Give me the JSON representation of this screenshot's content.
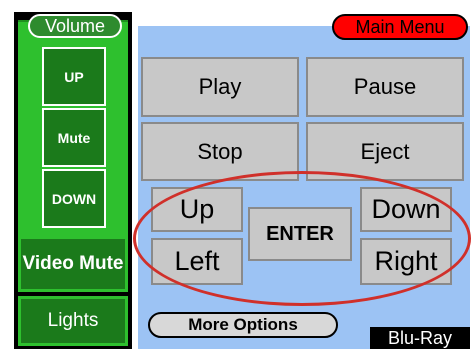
{
  "volume": {
    "title": "Volume",
    "up_label": "UP",
    "mute_label": "Mute",
    "down_label": "DOWN"
  },
  "sidebar": {
    "video_mute_label": "Video Mute",
    "lights_label": "Lights"
  },
  "main": {
    "menu_label": "Main Menu",
    "play_label": "Play",
    "pause_label": "Pause",
    "stop_label": "Stop",
    "eject_label": "Eject",
    "up_label": "Up",
    "down_label": "Down",
    "enter_label": "ENTER",
    "left_label": "Left",
    "right_label": "Right",
    "more_options_label": "More Options",
    "source_label": "Blu-Ray"
  },
  "colors": {
    "panel_green": "#2ec02e",
    "button_green": "#1b7a1b",
    "panel_blue": "#9cc3f4",
    "menu_red": "#ff0000",
    "button_gray": "#c8c8c8",
    "highlight_ring": "#d0302a"
  }
}
